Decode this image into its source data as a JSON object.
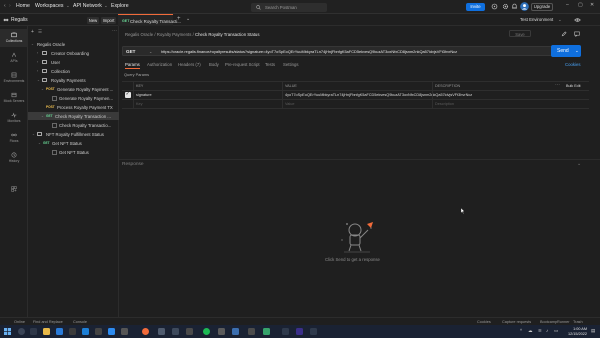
{
  "topbar": {
    "nav": [
      "Home",
      "Workspaces",
      "API Network",
      "Explore"
    ],
    "search_placeholder": "Search Postman",
    "invite_label": "Invite",
    "upgrade_label": "Upgrade"
  },
  "workspace": {
    "name": "Regalis",
    "new_label": "New",
    "import_label": "Import",
    "tab_method": "GET",
    "tab_name": "Check Royalty Transacti...",
    "environment": "Test Environment"
  },
  "rail": [
    "Collections",
    "APIs",
    "Environments",
    "Mock Servers",
    "Monitors",
    "Flows",
    "History"
  ],
  "sidebar": {
    "items": [
      {
        "label": "Regalis Oracle",
        "level": 0,
        "kind": "collection",
        "open": true
      },
      {
        "label": "Creator Onboarding",
        "level": 1,
        "kind": "folder",
        "open": false
      },
      {
        "label": "User",
        "level": 1,
        "kind": "folder",
        "open": false
      },
      {
        "label": "Collection",
        "level": 1,
        "kind": "folder",
        "open": false
      },
      {
        "label": "Royalty Payments",
        "level": 1,
        "kind": "folder",
        "open": true
      },
      {
        "label": "Generate Royalty Payment ...",
        "level": 2,
        "kind": "request",
        "method": "POST",
        "open": true
      },
      {
        "label": "Generate Royalty Paymen...",
        "level": 3,
        "kind": "example"
      },
      {
        "label": "Process Royalty Payment TX",
        "level": 2,
        "kind": "request",
        "method": "POST"
      },
      {
        "label": "Check Royalty Transaction ...",
        "level": 2,
        "kind": "request",
        "method": "GET",
        "open": true,
        "selected": true
      },
      {
        "label": "Check Royalty Transactio...",
        "level": 3,
        "kind": "example"
      },
      {
        "label": "NFT Royalty Fulfillment Status",
        "level": 1,
        "kind": "folder",
        "open": true
      },
      {
        "label": "Get NFT Status",
        "level": 2,
        "kind": "request",
        "method": "GET",
        "open": true
      },
      {
        "label": "Get NFT Status",
        "level": 3,
        "kind": "example"
      }
    ]
  },
  "request": {
    "breadcrumb_parent": "Regalis Oracle / Royalty Payments /",
    "breadcrumb_current": "Check Royalty Transaction Status",
    "save_label": "Save",
    "method": "GET",
    "url": "https://oracle.regalis.finance/royaltyresults/status?signature=4yoT7oSpEoQErYuuMbkyraTLn74jHnjFbnfgK5aFCD5ekvesQ9kuzAT3oxNfxCD8jsnm2nkQa57idvjsVFt3hvrNcz",
    "send_label": "Send",
    "tabs": [
      "Params",
      "Authorization",
      "Headers (7)",
      "Body",
      "Pre-request Script",
      "Tests",
      "Settings"
    ],
    "cookies_label": "Cookies",
    "params_title": "Query Params",
    "columns": [
      "KEY",
      "VALUE",
      "DESCRIPTION"
    ],
    "bulk_edit_label": "Bulk Edit",
    "params": [
      {
        "key": "signature",
        "value": "4yoT7oSpEoQErYuuMbkyraTLn74jHnjFbnfgK5aFCD5ekvesQ9kuzAT3oxNfxCD8jsnm2nkQa57idvjsVFt3hvrNcz",
        "checked": true
      }
    ],
    "placeholder_key": "Key",
    "placeholder_value": "Value",
    "placeholder_desc": "Description"
  },
  "response": {
    "title": "Response",
    "empty_message": "Click Send to get a response"
  },
  "statusbar": {
    "left": [
      "Online",
      "Find and Replace",
      "Console"
    ],
    "right": [
      "Cookies",
      "Capture requests",
      "Bootcamp",
      "Runner",
      "Trash"
    ]
  },
  "taskbar": {
    "time": "1:00 AM",
    "date": "12/15/2022"
  },
  "colors": {
    "accent_orange": "#f26b3a",
    "primary_blue": "#0f6fde",
    "get_green": "#6bdd9a",
    "post_yellow": "#f5c451"
  }
}
